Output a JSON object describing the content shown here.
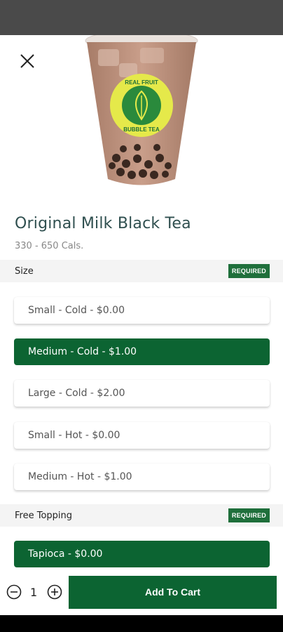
{
  "product": {
    "name": "Original Milk Black Tea",
    "calories": "330 - 650 Cals.",
    "logo_text_top": "REAL FRUIT",
    "logo_text_bottom": "BUBBLE TEA"
  },
  "size_section": {
    "label": "Size",
    "badge": "REQUIRED",
    "options": [
      {
        "label": "Small - Cold - $0.00",
        "selected": false
      },
      {
        "label": "Medium - Cold - $1.00",
        "selected": true
      },
      {
        "label": "Large - Cold - $2.00",
        "selected": false
      },
      {
        "label": "Small - Hot - $0.00",
        "selected": false
      },
      {
        "label": "Medium - Hot - $1.00",
        "selected": false
      }
    ]
  },
  "topping_section": {
    "label": "Free Topping",
    "badge": "REQUIRED",
    "options": [
      {
        "label": "Tapioca - $0.00",
        "selected": true
      }
    ]
  },
  "cart": {
    "quantity": "1",
    "add_label": "Add To Cart"
  },
  "colors": {
    "brand_green": "#0c6432",
    "badge_green": "#1f6f3b",
    "status_bar": "#4a4a4a"
  },
  "icons": {
    "close": "close-icon",
    "minus": "minus-circle-icon",
    "plus": "plus-circle-icon"
  }
}
